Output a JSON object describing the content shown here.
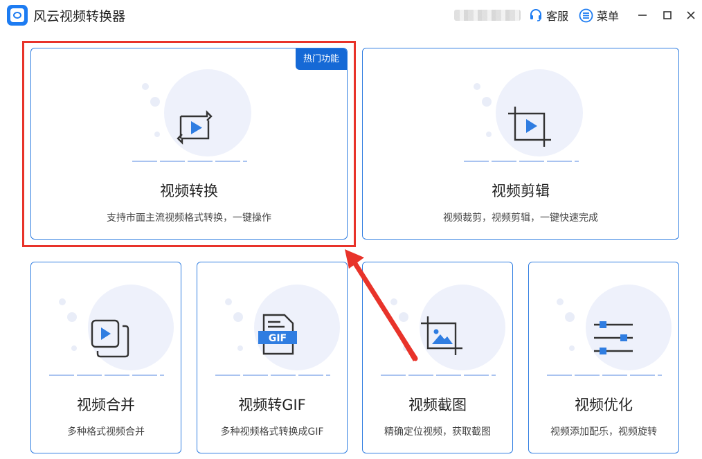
{
  "app": {
    "title": "风云视频转换器",
    "accent": "#1d7cf2"
  },
  "toolbar": {
    "service_label": "客服",
    "menu_label": "菜单"
  },
  "cards": {
    "convert": {
      "title": "视频转换",
      "desc": "支持市面主流视频格式转换，一键操作",
      "badge": "热门功能",
      "icon": "convert-video-icon"
    },
    "edit": {
      "title": "视频剪辑",
      "desc": "视频裁剪，视频剪辑，一键快速完成",
      "icon": "crop-video-icon"
    },
    "merge": {
      "title": "视频合并",
      "desc": "多种格式视频合并",
      "icon": "merge-video-icon"
    },
    "gif": {
      "title": "视频转GIF",
      "desc": "多种视频格式转换成GIF",
      "icon_text": "GIF",
      "icon": "gif-file-icon"
    },
    "screenshot": {
      "title": "视频截图",
      "desc": "精确定位视频，获取截图",
      "icon": "crop-image-icon"
    },
    "optimize": {
      "title": "视频优化",
      "desc": "视频添加配乐，视频旋转",
      "icon": "sliders-icon"
    }
  },
  "colors": {
    "card_border": "#2f7de1",
    "badge": "#1569d6",
    "highlight": "#e8332a",
    "play": "#2f7de1"
  }
}
